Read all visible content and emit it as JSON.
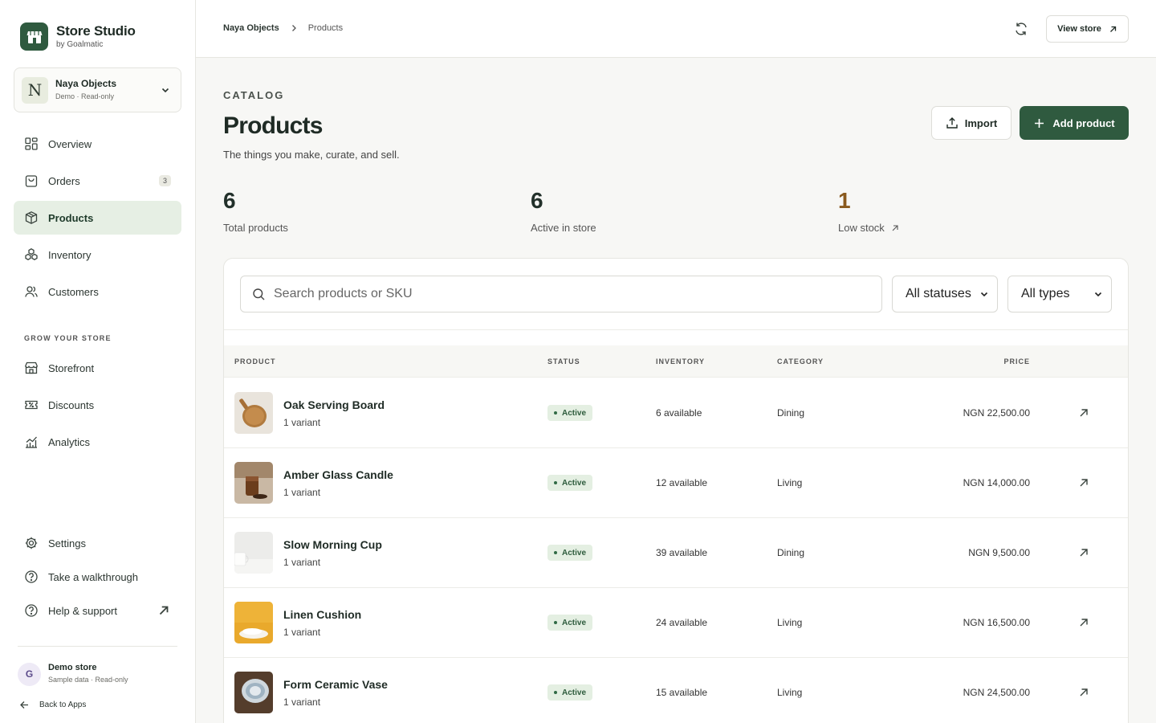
{
  "brand": {
    "title": "Store Studio",
    "subtitle": "by Goalmatic"
  },
  "store": {
    "initial": "N",
    "name": "Naya Objects",
    "meta": "Demo · Read-only"
  },
  "nav": {
    "items": [
      {
        "label": "Overview",
        "icon": "grid-icon"
      },
      {
        "label": "Orders",
        "icon": "bag-icon",
        "badge": "3"
      },
      {
        "label": "Products",
        "icon": "box-icon",
        "active": true
      },
      {
        "label": "Inventory",
        "icon": "stack-icon"
      },
      {
        "label": "Customers",
        "icon": "users-icon"
      }
    ],
    "section_label": "GROW YOUR STORE",
    "grow_items": [
      {
        "label": "Storefront",
        "icon": "storefront-icon"
      },
      {
        "label": "Discounts",
        "icon": "ticket-icon"
      },
      {
        "label": "Analytics",
        "icon": "chart-icon"
      }
    ],
    "bottom_items": [
      {
        "label": "Settings",
        "icon": "gear-icon"
      },
      {
        "label": "Take a walkthrough",
        "icon": "help-icon"
      },
      {
        "label": "Help & support",
        "icon": "help-icon"
      }
    ]
  },
  "demo": {
    "initial": "G",
    "title": "Demo store",
    "subtitle": "Sample data · Read-only"
  },
  "back_label": "Back to Apps",
  "breadcrumb": {
    "parent": "Naya Objects",
    "current": "Products"
  },
  "header": {
    "view_store": "View store"
  },
  "page": {
    "eyebrow": "CATALOG",
    "title": "Products",
    "description": "The things you make, curate, and sell.",
    "import_label": "Import",
    "add_label": "Add product"
  },
  "stats": [
    {
      "value": "6",
      "label": "Total products"
    },
    {
      "value": "6",
      "label": "Active in store"
    },
    {
      "value": "1",
      "label": "Low stock"
    }
  ],
  "colors": {
    "accent": "#2f5a3f",
    "low_stock": "#8a5a1e",
    "active_badge_bg": "#e4efe2"
  },
  "filters": {
    "search_placeholder": "Search products or SKU",
    "status": "All statuses",
    "type": "All types"
  },
  "table": {
    "headers": {
      "product": "PRODUCT",
      "status": "STATUS",
      "inventory": "INVENTORY",
      "category": "CATEGORY",
      "price": "PRICE"
    },
    "rows": [
      {
        "name": "Oak Serving Board",
        "variants": "1 variant",
        "status": "Active",
        "inventory": "6 available",
        "category": "Dining",
        "price": "NGN 22,500.00"
      },
      {
        "name": "Amber Glass Candle",
        "variants": "1 variant",
        "status": "Active",
        "inventory": "12 available",
        "category": "Living",
        "price": "NGN 14,000.00"
      },
      {
        "name": "Slow Morning Cup",
        "variants": "1 variant",
        "status": "Active",
        "inventory": "39 available",
        "category": "Dining",
        "price": "NGN 9,500.00"
      },
      {
        "name": "Linen Cushion",
        "variants": "1 variant",
        "status": "Active",
        "inventory": "24 available",
        "category": "Living",
        "price": "NGN 16,500.00"
      },
      {
        "name": "Form Ceramic Vase",
        "variants": "1 variant",
        "status": "Active",
        "inventory": "15 available",
        "category": "Living",
        "price": "NGN 24,500.00"
      }
    ]
  }
}
